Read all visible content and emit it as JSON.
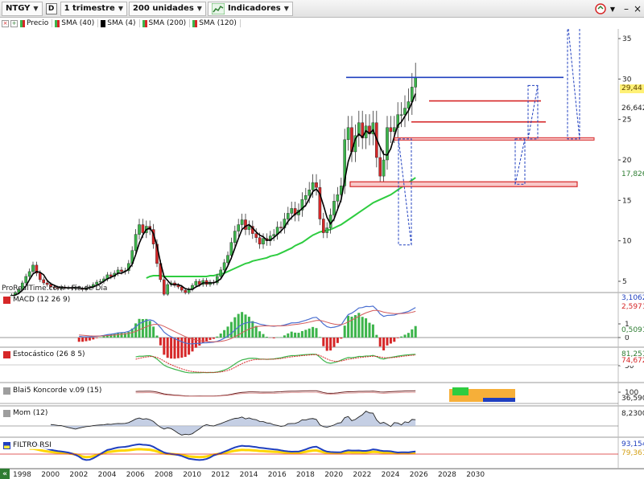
{
  "toolbar": {
    "symbol": "NTGY",
    "d_label": "D",
    "period": "1 trimestre",
    "units": "200 unidades",
    "indicators": "Indicadores"
  },
  "legend": {
    "price": "Precio",
    "sma40": "SMA (40)",
    "sma4": "SMA (4)",
    "sma200": "SMA (200)",
    "sma120": "SMA (120)"
  },
  "source": "ProRealTime.com - Fin de Día",
  "colors": {
    "up": "#3cb44b",
    "down": "#d62728",
    "sma4": "#000000",
    "sma40": "#2ecc40",
    "blue_line": "#1f3fbf",
    "red_line": "#d62728"
  },
  "price_axis": {
    "ticks": [
      "35",
      "30",
      "25",
      "20",
      "15",
      "10",
      "5"
    ],
    "badges": [
      {
        "text": "29,44",
        "color": "#d4a017",
        "bg": "#fff176"
      },
      {
        "text": "26,642",
        "color": "#222",
        "bg": "#ffffff"
      },
      {
        "text": "17,826",
        "color": "#2e7d32",
        "bg": "#ffffff"
      }
    ]
  },
  "panes": {
    "macd": {
      "label": "MACD (12 26 9)",
      "ticks": [
        "1",
        "0"
      ],
      "badges": [
        {
          "text": "3,1062",
          "color": "#1f3fbf"
        },
        {
          "text": "2,5971",
          "color": "#d62728"
        },
        {
          "text": "0,5091",
          "color": "#2e7d32"
        }
      ]
    },
    "stoch": {
      "label": "Estocástico (26 8 5)",
      "ticks": [
        "50"
      ],
      "badges": [
        {
          "text": "81,251",
          "color": "#2e7d32"
        },
        {
          "text": "74,672",
          "color": "#d62728"
        }
      ]
    },
    "konc": {
      "label": "Blai5 Koncorde v.09 (15)",
      "ticks": [
        "100"
      ],
      "badges": [
        {
          "text": "36,590",
          "color": "#222"
        }
      ]
    },
    "mom": {
      "label": "Mom (12)",
      "ticks": [],
      "badges": [
        {
          "text": "8,2300",
          "color": "#222"
        }
      ]
    },
    "rsi": {
      "label": "FILTRO RSI",
      "ticks": [],
      "badges": [
        {
          "text": "93,154",
          "color": "#1f3fbf"
        },
        {
          "text": "79,361",
          "color": "#d4a017"
        }
      ]
    }
  },
  "xaxis": [
    "1998",
    "2000",
    "2002",
    "2004",
    "2006",
    "2008",
    "2010",
    "2012",
    "2014",
    "2016",
    "2018",
    "2020",
    "2022",
    "2024",
    "2026",
    "2028",
    "2030"
  ],
  "chart_data": {
    "type": "candlestick",
    "frequency": "quarterly",
    "ylim": [
      0,
      38
    ],
    "x": [
      "1998Q1",
      "1998Q2",
      "1998Q3",
      "1998Q4",
      "1999Q1",
      "1999Q2",
      "1999Q3",
      "1999Q4",
      "2000Q1",
      "2000Q2",
      "2000Q3",
      "2000Q4",
      "2001Q1",
      "2001Q2",
      "2001Q3",
      "2001Q4",
      "2002Q1",
      "2002Q2",
      "2002Q3",
      "2002Q4",
      "2003Q1",
      "2003Q2",
      "2003Q3",
      "2003Q4",
      "2004Q1",
      "2004Q2",
      "2004Q3",
      "2004Q4",
      "2005Q1",
      "2005Q2",
      "2005Q3",
      "2005Q4",
      "2006Q1",
      "2006Q2",
      "2006Q3",
      "2006Q4",
      "2007Q1",
      "2007Q2",
      "2007Q3",
      "2007Q4",
      "2008Q1",
      "2008Q2",
      "2008Q3",
      "2008Q4",
      "2009Q1",
      "2009Q2",
      "2009Q3",
      "2009Q4",
      "2010Q1",
      "2010Q2",
      "2010Q3",
      "2010Q4",
      "2011Q1",
      "2011Q2",
      "2011Q3",
      "2011Q4",
      "2012Q1",
      "2012Q2",
      "2012Q3",
      "2012Q4",
      "2013Q1",
      "2013Q2",
      "2013Q3",
      "2013Q4",
      "2014Q1",
      "2014Q2",
      "2014Q3",
      "2014Q4",
      "2015Q1",
      "2015Q2",
      "2015Q3",
      "2015Q4",
      "2016Q1",
      "2016Q2",
      "2016Q3",
      "2016Q4",
      "2017Q1",
      "2017Q2",
      "2017Q3",
      "2017Q4",
      "2018Q1",
      "2018Q2",
      "2018Q3",
      "2018Q4",
      "2019Q1",
      "2019Q2",
      "2019Q3",
      "2019Q4",
      "2020Q1",
      "2020Q2",
      "2020Q3",
      "2020Q4",
      "2021Q1",
      "2021Q2",
      "2021Q3",
      "2021Q4",
      "2022Q1",
      "2022Q2",
      "2022Q3",
      "2022Q4",
      "2023Q1",
      "2023Q2",
      "2023Q3",
      "2023Q4",
      "2024Q1",
      "2024Q2",
      "2024Q3",
      "2024Q4",
      "2025Q1",
      "2025Q2",
      "2025Q3",
      "2025Q4",
      "2026Q1",
      "2026Q2"
    ],
    "close": [
      3.0,
      3.3,
      3.6,
      4.0,
      4.8,
      5.6,
      6.2,
      7.0,
      6.0,
      5.2,
      4.8,
      4.6,
      4.3,
      4.2,
      4.1,
      4.3,
      4.2,
      4.2,
      4.1,
      4.2,
      4.1,
      4.0,
      4.2,
      4.3,
      4.6,
      4.9,
      5.0,
      5.3,
      5.8,
      5.6,
      6.0,
      6.4,
      6.2,
      6.3,
      7.2,
      8.8,
      10.8,
      12.0,
      11.0,
      11.8,
      11.4,
      9.6,
      7.2,
      5.2,
      3.4,
      4.6,
      4.8,
      4.5,
      4.3,
      3.9,
      3.6,
      4.0,
      4.5,
      5.0,
      4.6,
      5.1,
      4.6,
      4.9,
      4.8,
      5.6,
      6.4,
      7.3,
      8.2,
      9.8,
      11.2,
      12.0,
      12.6,
      11.4,
      11.8,
      10.9,
      10.4,
      9.6,
      10.3,
      10.0,
      10.6,
      10.8,
      11.7,
      11.6,
      12.7,
      13.4,
      14.0,
      13.2,
      13.8,
      15.1,
      15.6,
      16.3,
      17.2,
      16.6,
      12.7,
      11.0,
      11.6,
      13.2,
      14.9,
      15.7,
      16.8,
      22.5,
      24.0,
      21.0,
      23.0,
      24.6,
      22.7,
      24.2,
      23.2,
      24.6,
      20.3,
      18.0,
      20.0,
      24.0,
      23.5,
      24.0,
      25.6,
      25.6,
      26.4,
      27.2,
      29.0,
      30.2
    ],
    "sma4": [
      3.0,
      3.2,
      3.3,
      3.5,
      3.9,
      4.4,
      5.2,
      5.9,
      6.2,
      6.1,
      5.8,
      5.1,
      4.7,
      4.5,
      4.3,
      4.2,
      4.2,
      4.2,
      4.2,
      4.2,
      4.2,
      4.1,
      4.1,
      4.2,
      4.3,
      4.5,
      4.7,
      5.0,
      5.3,
      5.5,
      5.7,
      6.0,
      6.0,
      6.2,
      6.5,
      7.1,
      8.3,
      9.7,
      10.7,
      11.4,
      11.6,
      10.9,
      9.4,
      7.3,
      5.6,
      5.1,
      4.6,
      4.6,
      4.6,
      4.4,
      4.1,
      4.0,
      4.0,
      4.3,
      4.5,
      4.8,
      4.8,
      4.8,
      4.8,
      5.0,
      5.3,
      6.0,
      6.9,
      7.9,
      9.1,
      10.3,
      11.4,
      11.8,
      12.0,
      11.6,
      11.1,
      10.7,
      10.5,
      10.1,
      10.1,
      10.4,
      10.8,
      11.2,
      11.7,
      12.4,
      12.9,
      13.3,
      13.6,
      14.0,
      14.4,
      15.2,
      16.1,
      16.4,
      15.8,
      14.4,
      12.9,
      12.1,
      12.7,
      13.9,
      15.1,
      17.5,
      19.8,
      21.1,
      22.6,
      23.2,
      22.8,
      23.6,
      23.3,
      23.7,
      22.6,
      21.6,
      20.7,
      20.6,
      21.4,
      22.9,
      24.3,
      24.7,
      25.4,
      26.1,
      27.1,
      28.2
    ],
    "sma40": [
      null,
      null,
      null,
      null,
      null,
      null,
      null,
      null,
      null,
      null,
      null,
      null,
      null,
      null,
      null,
      null,
      null,
      null,
      null,
      null,
      null,
      null,
      null,
      null,
      null,
      null,
      null,
      null,
      null,
      null,
      null,
      null,
      null,
      null,
      null,
      null,
      null,
      null,
      null,
      5.4,
      5.6,
      5.7,
      5.7,
      5.7,
      5.6,
      5.6,
      5.6,
      5.6,
      5.6,
      5.6,
      5.6,
      5.6,
      5.6,
      5.6,
      5.6,
      5.6,
      5.6,
      5.7,
      5.7,
      5.8,
      5.9,
      6.0,
      6.2,
      6.4,
      6.6,
      6.8,
      7.0,
      7.2,
      7.3,
      7.5,
      7.6,
      7.7,
      7.8,
      7.9,
      8.1,
      8.2,
      8.3,
      8.5,
      8.7,
      8.9,
      9.1,
      9.4,
      9.6,
      9.8,
      10.1,
      10.4,
      10.7,
      10.9,
      11.1,
      11.2,
      11.3,
      11.4,
      11.6,
      11.8,
      12.0,
      12.3,
      12.6,
      12.9,
      13.2,
      13.5,
      13.8,
      14.1,
      14.4,
      14.7,
      14.9,
      15.1,
      15.3,
      15.5,
      15.7,
      16.0,
      16.3,
      16.6,
      16.9,
      17.2,
      17.5,
      17.8
    ],
    "levels": [
      {
        "y": 30.2,
        "color": "blue"
      },
      {
        "y": 27.3,
        "color": "red"
      },
      {
        "y": 24.7,
        "color": "red"
      },
      {
        "y": 22.6,
        "color": "red"
      },
      {
        "y": 17.0,
        "color": "red"
      }
    ]
  }
}
